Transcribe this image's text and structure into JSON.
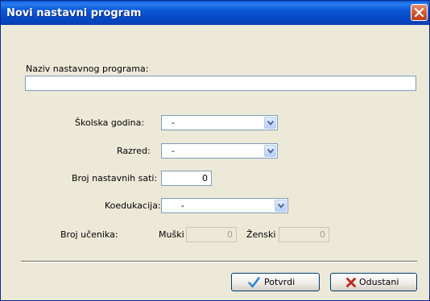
{
  "window": {
    "title": "Novi nastavni program"
  },
  "form": {
    "program_name_label": "Naziv nastavnog programa:",
    "program_name_value": "",
    "school_year_label": "Školska godina:",
    "school_year_value": "-",
    "grade_label": "Razred:",
    "grade_value": "-",
    "hours_label": "Broj nastavnih sati:",
    "hours_value": "0",
    "coeducation_label": "Koedukacija:",
    "coeducation_value": "-",
    "students_label": "Broj učenika:",
    "male_label": "Muški",
    "male_value": "0",
    "female_label": "Ženski",
    "female_value": "0"
  },
  "buttons": {
    "confirm_label": "Potvrdi",
    "cancel_label": "Odustani"
  },
  "icons": {
    "close": "close-icon",
    "dropdown": "chevron-down-icon",
    "confirm": "checkmark-icon",
    "cancel": "x-icon"
  },
  "colors": {
    "titlebar": "#0a5ad8",
    "close_button": "#d2552c",
    "checkmark": "#2a7fd4",
    "cancel_x": "#c0281a",
    "dialog_bg": "#ece9d8"
  }
}
